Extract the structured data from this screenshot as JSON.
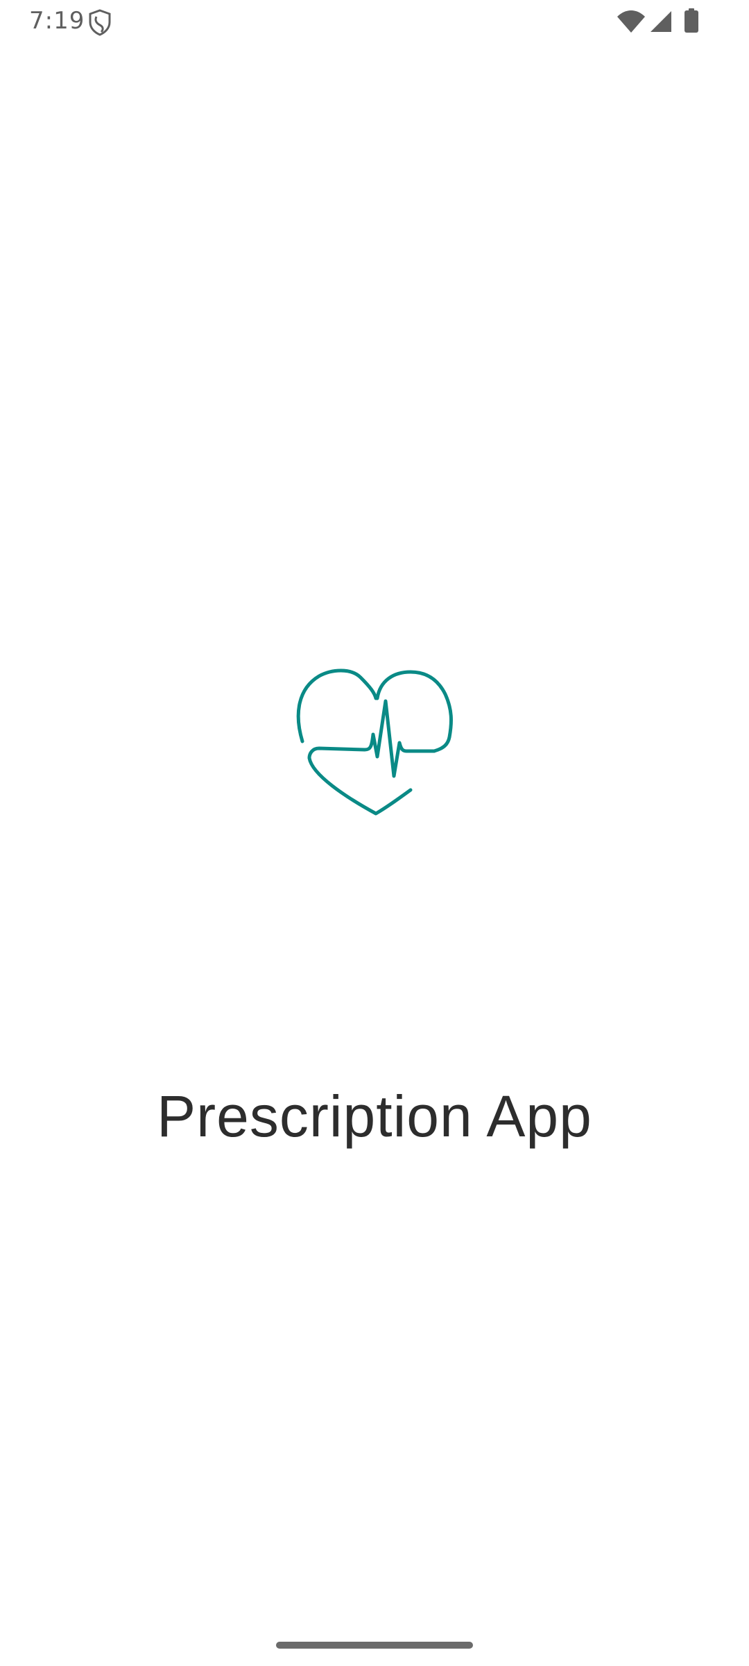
{
  "status_bar": {
    "time": "7:19",
    "icons": [
      "shield-icon",
      "wifi-icon",
      "cellular-signal-icon",
      "battery-icon"
    ]
  },
  "splash": {
    "logo_icon": "heart-pulse-icon",
    "title": "Prescription App"
  },
  "colors": {
    "accent": "#0a8a86",
    "title_text": "#2d2d2d",
    "status_icons": "#5f5f5f",
    "background": "#ffffff"
  }
}
